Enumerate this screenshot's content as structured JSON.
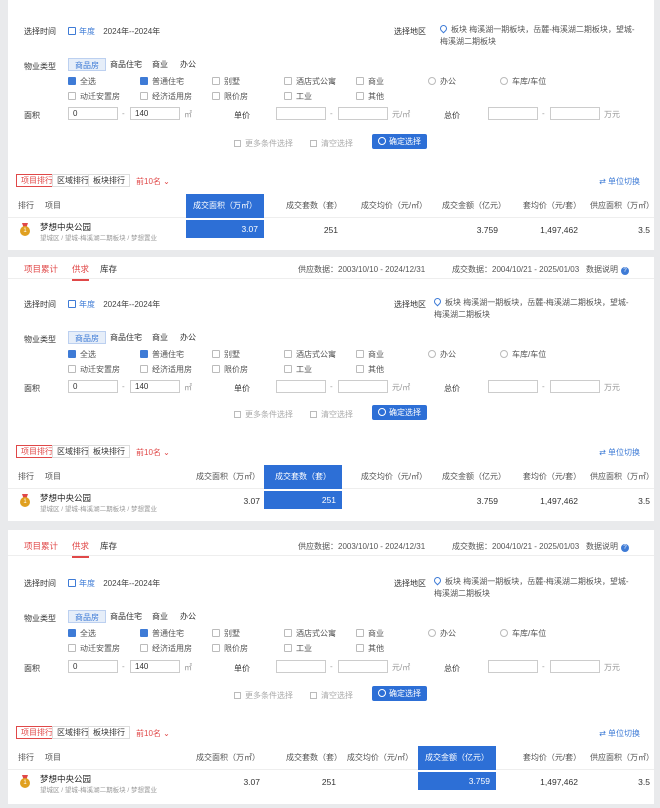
{
  "header": {
    "tab_project": "项目累计",
    "tab_supply": "供求",
    "tab_stock": "库存",
    "supply_label": "供应数据：",
    "supply_range": "2003/10/10 - 2024/12/31",
    "deal_label": "成交数据：",
    "deal_range": "2004/10/21 - 2025/01/03",
    "data_note": "数据说明",
    "info_glyph": "?"
  },
  "filter": {
    "time_label": "选择时间",
    "year_label": "年度",
    "year_range": "2024年--2024年",
    "region_label": "选择地区",
    "region_value": "板块 梅溪湖一期板块，岳麓-梅溪湖二期板块，望城-梅溪湖二期板块",
    "type_label": "物业类型",
    "type_tabs": [
      "商品房",
      "商品住宅",
      "商业",
      "办公"
    ],
    "checks_row1": [
      "全选",
      "普通住宅",
      "别墅",
      "酒店式公寓",
      "商业",
      "办公",
      "车库/车位"
    ],
    "checks_row2": [
      "动迁安置房",
      "经济适用房",
      "限价房",
      "工业",
      "其他"
    ],
    "area_label": "面积",
    "area_min": "0",
    "area_max": "140",
    "area_unit": "㎡",
    "price_label": "单价",
    "price_unit": "元/㎡",
    "total_label": "总价",
    "total_unit": "万元",
    "range_dash": "-",
    "more_btn": "更多条件选择",
    "clear_btn": "清空选择",
    "confirm_btn": "确定选择"
  },
  "rank": {
    "tabs": [
      "项目排行",
      "区域排行",
      "板块排行"
    ],
    "topn": "前10名 ⌄",
    "switch": "单位切换"
  },
  "table": {
    "headers": [
      "排行",
      "项目",
      "成交面积（万㎡）",
      "成交套数（套）",
      "成交均价（元/㎡）",
      "成交金额（亿元）",
      "套均价（元/套）",
      "供应面积（万㎡）"
    ],
    "row": {
      "rank": "1",
      "project": "梦想中央公园",
      "project_sub": "望城区 / 望城-梅溪湖二期板块 / 梦想置业",
      "area": "3.07",
      "units": "251",
      "avg_price": "",
      "amount": "3.759",
      "unit_avg": "1,497,462",
      "supply": "3.5"
    }
  },
  "colors": {
    "accent_blue": "#2d6fd6",
    "accent_red": "#e04848"
  }
}
